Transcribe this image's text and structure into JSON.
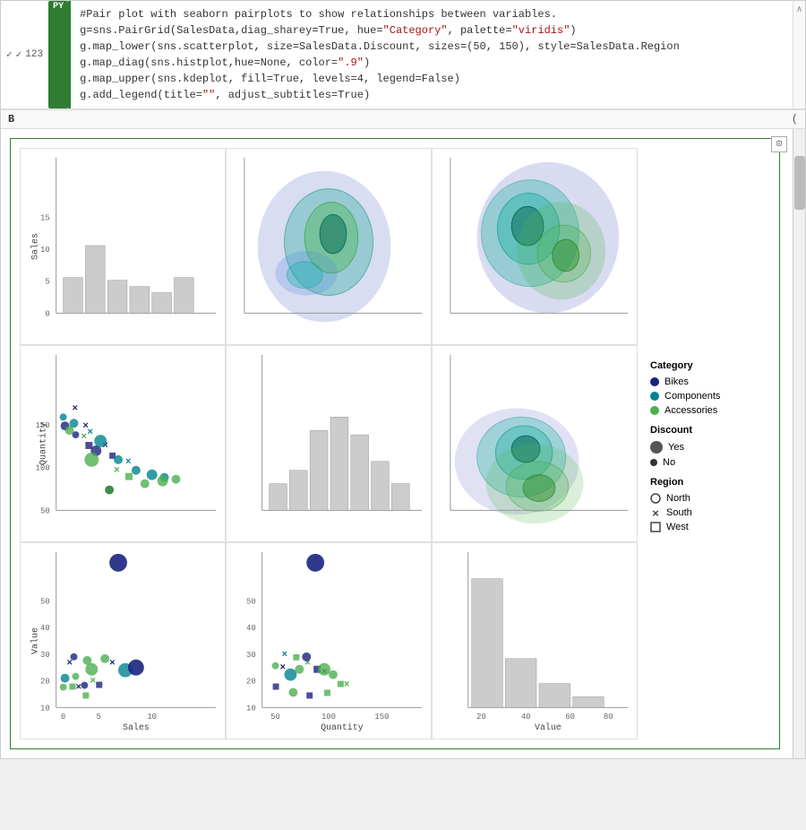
{
  "cell": {
    "run_controls": [
      "✓",
      "✓",
      "123"
    ],
    "py_label": "PY",
    "code_lines": [
      "#Pair plot with seaborn pairplots to show relationships between variables.",
      "g=sns.PairGrid(SalesData,diag_sharey=True, hue=\"Category\", palette=\"viridis\")",
      "g.map_lower(sns.scatterplot, size=SalesData.Discount, sizes=(50, 150), style=SalesData.Region",
      "g.map_diag(sns.histplot,hue=None, color=\".9\")",
      "g.map_upper(sns.kdeplot, fill=True, levels=4, legend=False)",
      "g.add_legend(title=\"\", adjust_subtitles=True)"
    ],
    "output_tab": "B",
    "legend": {
      "category_title": "Category",
      "categories": [
        {
          "label": "Bikes",
          "color": "#1a237e"
        },
        {
          "label": "Components",
          "color": "#00838f"
        },
        {
          "label": "Accessories",
          "color": "#4caf50"
        }
      ],
      "discount_title": "Discount",
      "discounts": [
        {
          "label": "Yes",
          "size": "large"
        },
        {
          "label": "No",
          "size": "small"
        }
      ],
      "region_title": "Region",
      "regions": [
        {
          "label": "North",
          "marker": "circle"
        },
        {
          "label": "South",
          "marker": "cross"
        },
        {
          "label": "West",
          "marker": "square"
        }
      ]
    },
    "axis_labels": {
      "row1_y": "Sales",
      "row2_y": "Quantity",
      "row3_y": "Value",
      "col1_x": "Sales",
      "col2_x": "Quantity",
      "col3_x": "Value"
    }
  }
}
